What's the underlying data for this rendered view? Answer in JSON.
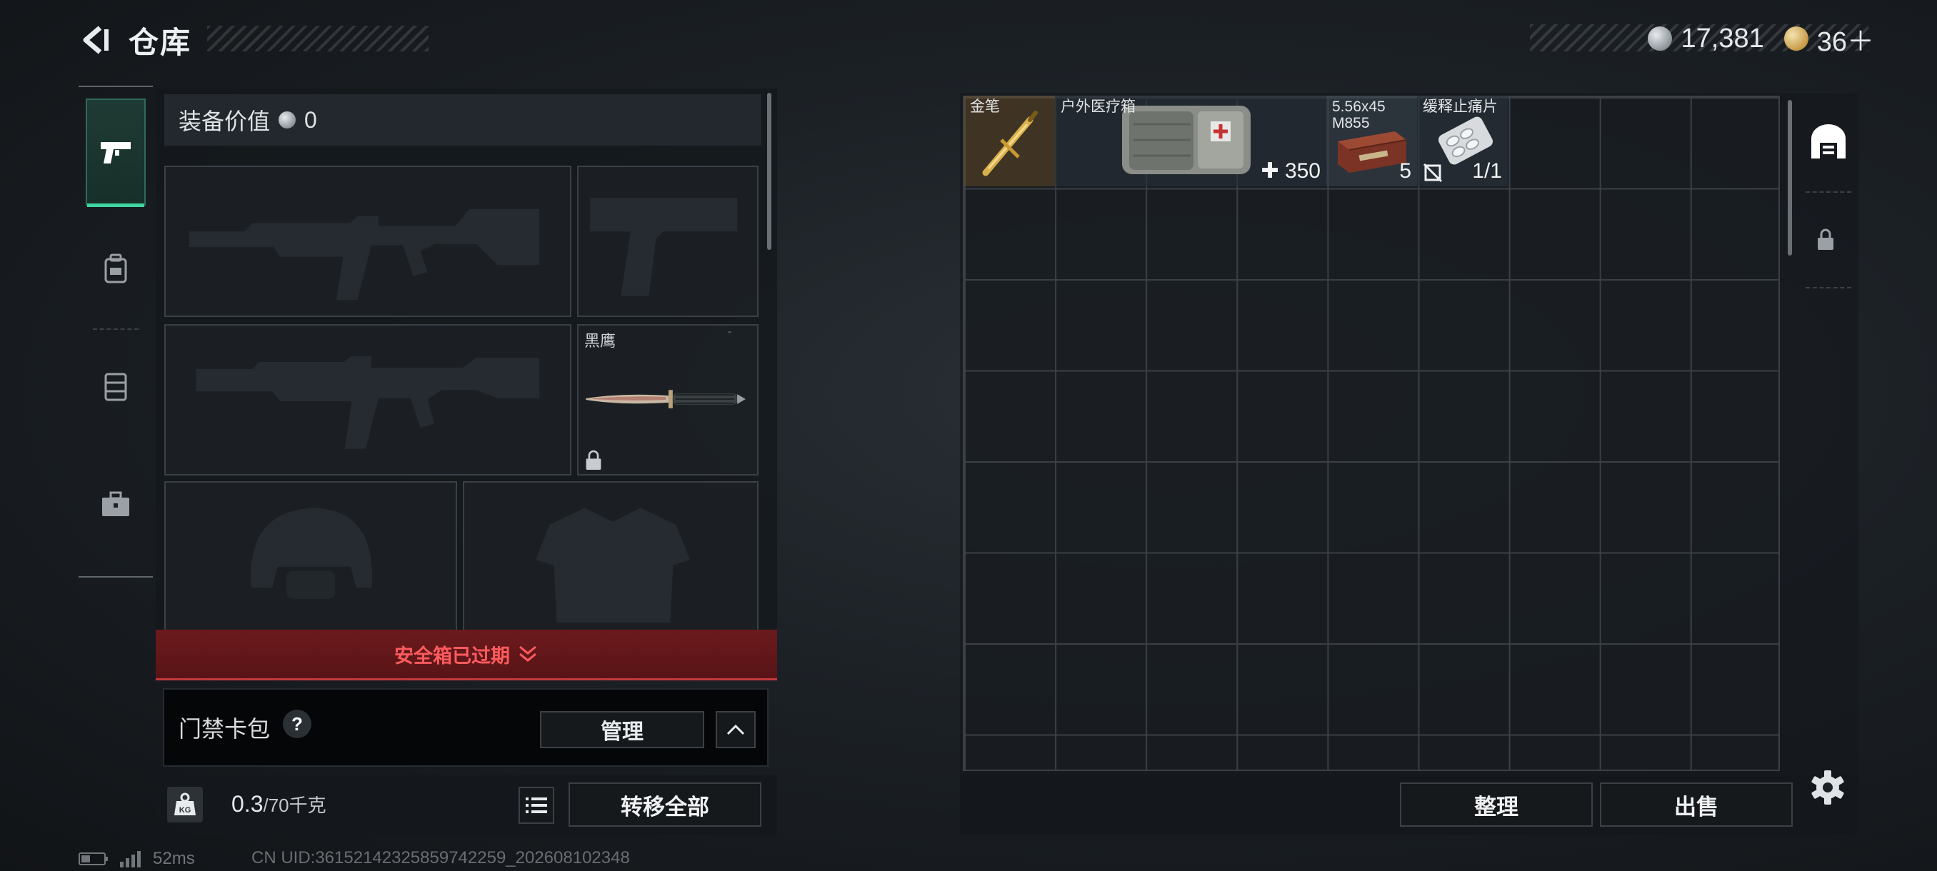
{
  "header": {
    "title": "仓库",
    "silver_amount": "17,381",
    "gold_amount": "36＋"
  },
  "sidebar": {
    "tabs": [
      {
        "icon": "pistol-icon",
        "active": true
      },
      {
        "icon": "backpack-icon",
        "active": false
      },
      {
        "icon": "chest-rig-icon",
        "active": false
      },
      {
        "icon": "toolbox-icon",
        "active": false
      }
    ]
  },
  "equipment": {
    "value_label": "装备价值",
    "value": "0",
    "slots": [
      {
        "id": "primary-weapon-1",
        "name": "",
        "empty": true
      },
      {
        "id": "pistol",
        "name": "",
        "empty": true
      },
      {
        "id": "primary-weapon-2",
        "name": "",
        "empty": true
      },
      {
        "id": "melee",
        "name": "黑鹰",
        "empty": false,
        "locked": true
      },
      {
        "id": "helmet",
        "name": "",
        "empty": true
      },
      {
        "id": "armor",
        "name": "",
        "empty": true
      }
    ],
    "safe_box_status": "安全箱已过期",
    "keycard": {
      "label": "门禁卡包",
      "manage_label": "管理"
    },
    "weight_current": "0.3",
    "weight_max": "/70千克",
    "weight_icon_text": "KG",
    "transfer_all_label": "转移全部"
  },
  "stash": {
    "items": [
      {
        "name": "金笔",
        "count": ""
      },
      {
        "name": "户外医疗箱",
        "count": "350"
      },
      {
        "name": "5.56x45 M855",
        "count": "5"
      },
      {
        "name": "缓释止痛片",
        "count": "1/1"
      }
    ],
    "sort_label": "整理",
    "sell_label": "出售"
  },
  "status_bar": {
    "ping": "52ms",
    "uid": "CN UID:36152142325859742259_202608102348"
  },
  "colors": {
    "accent_green": "#3fd6a2",
    "warning_red": "#ff5b5e",
    "expired_bg": "#6b1a1c"
  }
}
